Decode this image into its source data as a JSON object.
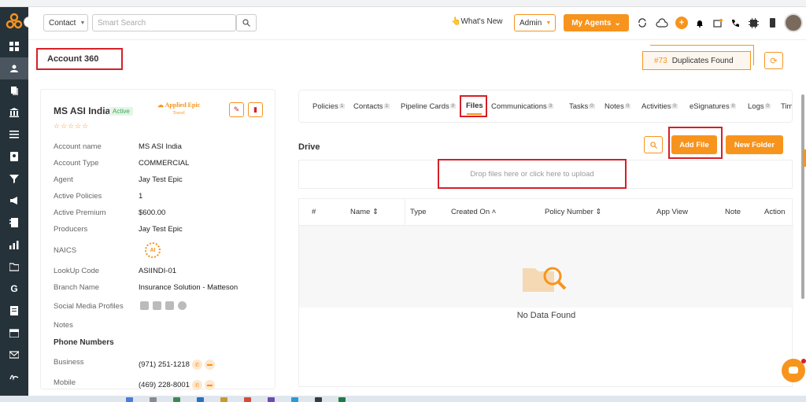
{
  "topbar": {
    "module_select": "Contact",
    "search_placeholder": "Smart Search",
    "whats_new": "What's New",
    "role_select": "Admin",
    "my_agents": "My Agents",
    "my_agents_chevron": "⌄"
  },
  "page": {
    "title": "Account 360",
    "duplicates_count": "#73",
    "duplicates_label": "Duplicates Found"
  },
  "account": {
    "name": "MS ASI India",
    "status": "Active",
    "stars": "☆☆☆☆☆",
    "partner_logo_line1": "Applied Epic",
    "partner_logo_line2": "Travel",
    "fields": [
      {
        "label": "Account name",
        "value": "MS ASI India"
      },
      {
        "label": "Account Type",
        "value": "COMMERCIAL"
      },
      {
        "label": "Agent",
        "value": "Jay Test Epic"
      },
      {
        "label": "Active Policies",
        "value": "1"
      },
      {
        "label": "Active Premium",
        "value": "$600.00"
      },
      {
        "label": "Producers",
        "value": "Jay Test Epic"
      },
      {
        "label": "NAICS",
        "value": ""
      },
      {
        "label": "LookUp Code",
        "value": "ASIINDI-01"
      },
      {
        "label": "Branch Name",
        "value": "Insurance Solution - Matteson"
      },
      {
        "label": "Social Media Profiles",
        "value": ""
      },
      {
        "label": "Notes",
        "value": ""
      }
    ],
    "naics_icon_text": "AI",
    "phone_heading": "Phone Numbers",
    "phones": [
      {
        "label": "Business",
        "value": "(971) 251-1218"
      },
      {
        "label": "Mobile",
        "value": "(469) 228-8001"
      }
    ]
  },
  "tabs": [
    {
      "label": "Policies",
      "count": "1"
    },
    {
      "label": "Contacts",
      "count": "1"
    },
    {
      "label": "Pipeline Cards",
      "count": "0"
    },
    {
      "label": "Files",
      "count": ""
    },
    {
      "label": "Communications",
      "count": "3"
    },
    {
      "label": "Tasks",
      "count": "0"
    },
    {
      "label": "Notes",
      "count": "0"
    },
    {
      "label": "Activities",
      "count": "0"
    },
    {
      "label": "eSignatures",
      "count": "0"
    },
    {
      "label": "Logs",
      "count": "0"
    },
    {
      "label": "Tim",
      "count": ""
    }
  ],
  "drive": {
    "heading": "Drive",
    "add_file": "Add File",
    "new_folder": "New Folder",
    "drop_text": "Drop files here or click here to upload",
    "columns": [
      "#",
      "Name",
      "Type",
      "Created On",
      "Policy Number",
      "App View",
      "Note",
      "Action"
    ],
    "sort_both": "⇕",
    "sort_up": "˄",
    "empty_text": "No Data Found"
  },
  "colors": {
    "accent": "#f7941d",
    "highlight": "#d62027",
    "sidebar": "#26323a"
  }
}
